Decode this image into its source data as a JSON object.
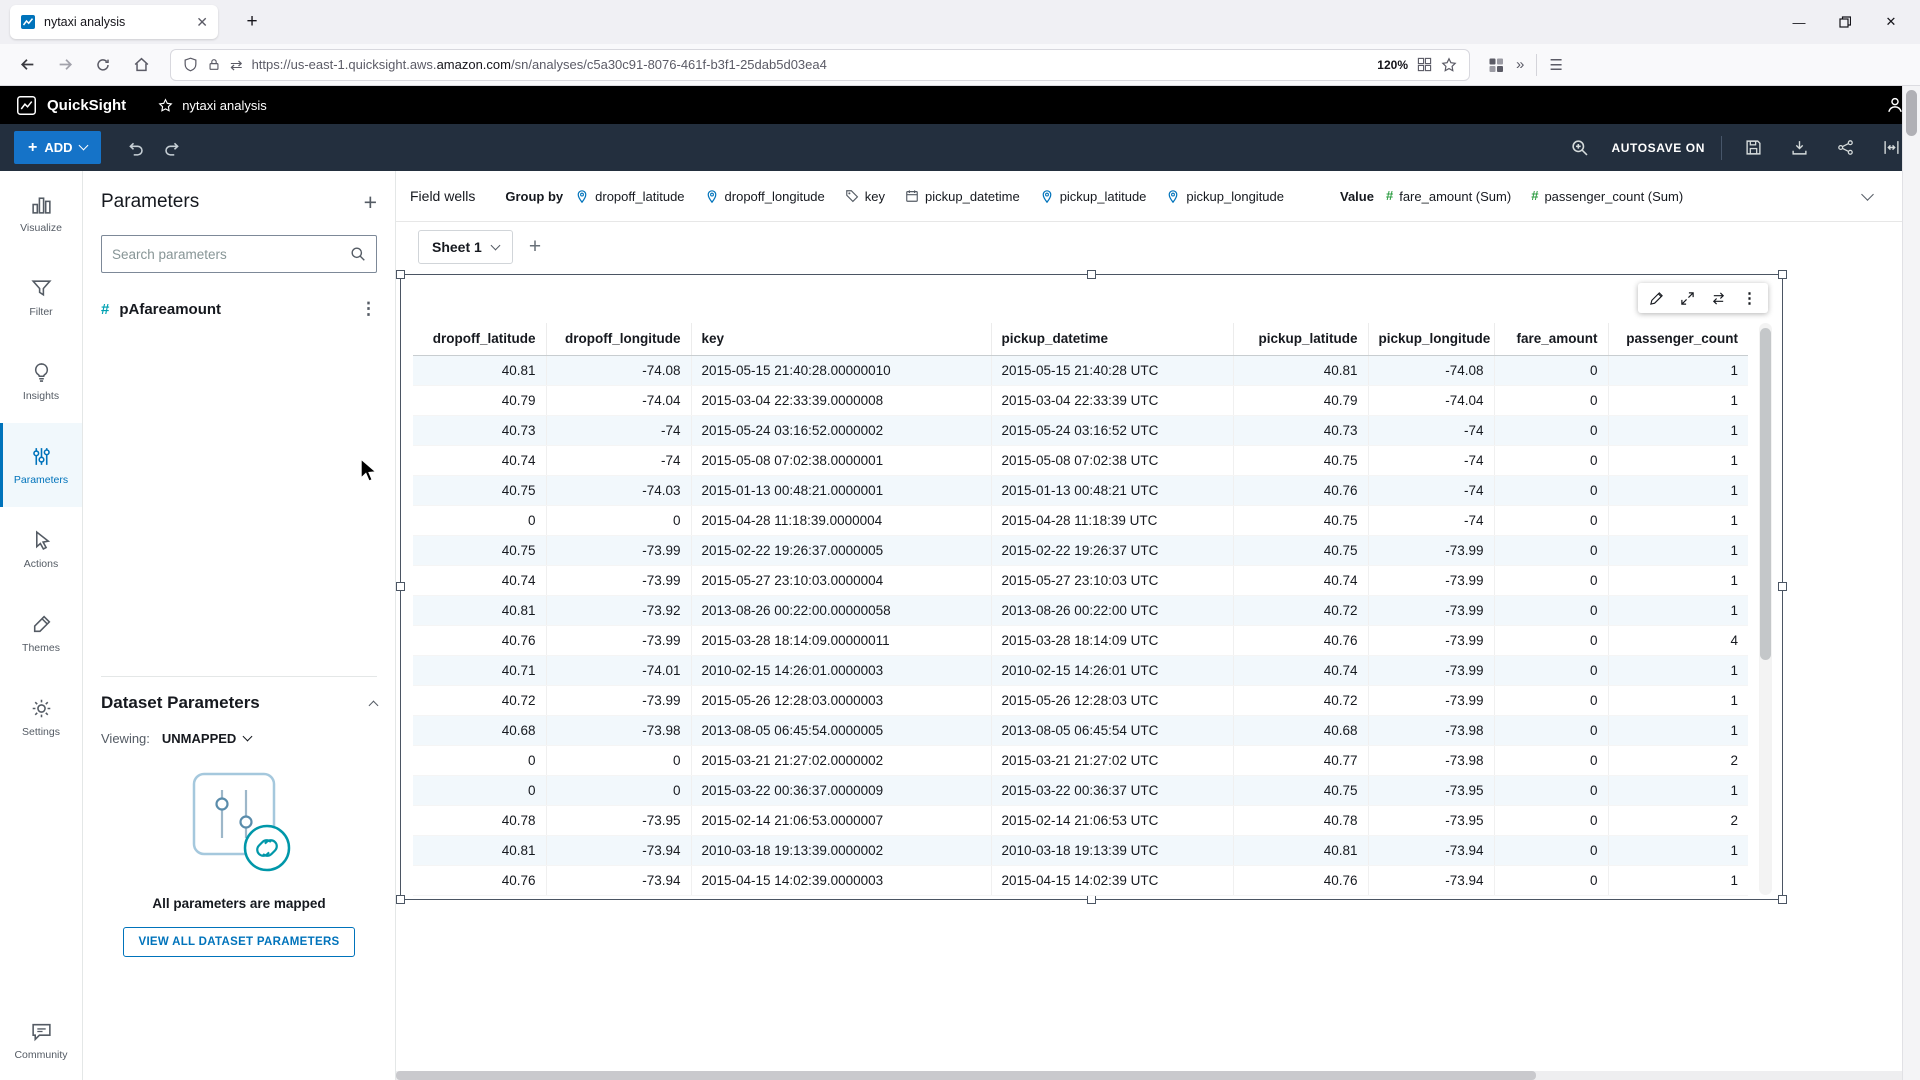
{
  "browser": {
    "tab_title": "nytaxi analysis",
    "url_prefix": "https://us-east-1.quicksight.aws.",
    "url_domain": "amazon.com",
    "url_path": "/sn/analyses/c5a30c91-8076-461f-b3f1-25dab5d03ea4",
    "zoom_badge": "120%"
  },
  "app_header": {
    "brand": "QuickSight",
    "analysis_title": "nytaxi analysis"
  },
  "toolbar": {
    "add_label": "ADD",
    "autosave_label": "AUTOSAVE ON"
  },
  "field_wells": {
    "bar_label": "Field wells",
    "group_by_label": "Group by",
    "value_label": "Value",
    "group_by_fields": [
      {
        "label": "dropoff_latitude",
        "icon": "pin"
      },
      {
        "label": "dropoff_longitude",
        "icon": "pin"
      },
      {
        "label": "key",
        "icon": "tag"
      },
      {
        "label": "pickup_datetime",
        "icon": "calendar"
      },
      {
        "label": "pickup_latitude",
        "icon": "pin"
      },
      {
        "label": "pickup_longitude",
        "icon": "pin"
      }
    ],
    "value_fields": [
      {
        "label": "fare_amount (Sum)",
        "icon": "hash"
      },
      {
        "label": "passenger_count (Sum)",
        "icon": "hash"
      }
    ]
  },
  "sheet_bar": {
    "sheet_name": "Sheet 1"
  },
  "left_rail": {
    "items": [
      {
        "label": "Visualize"
      },
      {
        "label": "Filter"
      },
      {
        "label": "Insights"
      },
      {
        "label": "Parameters"
      },
      {
        "label": "Actions"
      },
      {
        "label": "Themes"
      },
      {
        "label": "Settings"
      }
    ],
    "community_label": "Community"
  },
  "parameters_panel": {
    "title": "Parameters",
    "search_placeholder": "Search parameters",
    "parameter_name": "pAfareamount",
    "dataset_section": {
      "title": "Dataset Parameters",
      "viewing_label": "Viewing:",
      "viewing_value": "UNMAPPED",
      "mapped_message": "All parameters are mapped",
      "view_all_button": "VIEW ALL DATASET PARAMETERS"
    }
  },
  "visual": {
    "table": {
      "columns": [
        "dropoff_latitude",
        "dropoff_longitude",
        "key",
        "pickup_datetime",
        "pickup_latitude",
        "pickup_longitude",
        "fare_amount",
        "passenger_count"
      ],
      "rows": [
        [
          "40.81",
          "-74.08",
          "2015-05-15 21:40:28.00000010",
          "2015-05-15 21:40:28 UTC",
          "40.81",
          "-74.08",
          "0",
          "1"
        ],
        [
          "40.79",
          "-74.04",
          "2015-03-04 22:33:39.0000008",
          "2015-03-04 22:33:39 UTC",
          "40.79",
          "-74.04",
          "0",
          "1"
        ],
        [
          "40.73",
          "-74",
          "2015-05-24 03:16:52.0000002",
          "2015-05-24 03:16:52 UTC",
          "40.73",
          "-74",
          "0",
          "1"
        ],
        [
          "40.74",
          "-74",
          "2015-05-08 07:02:38.0000001",
          "2015-05-08 07:02:38 UTC",
          "40.75",
          "-74",
          "0",
          "1"
        ],
        [
          "40.75",
          "-74.03",
          "2015-01-13 00:48:21.0000001",
          "2015-01-13 00:48:21 UTC",
          "40.76",
          "-74",
          "0",
          "1"
        ],
        [
          "0",
          "0",
          "2015-04-28 11:18:39.0000004",
          "2015-04-28 11:18:39 UTC",
          "40.75",
          "-74",
          "0",
          "1"
        ],
        [
          "40.75",
          "-73.99",
          "2015-02-22 19:26:37.0000005",
          "2015-02-22 19:26:37 UTC",
          "40.75",
          "-73.99",
          "0",
          "1"
        ],
        [
          "40.74",
          "-73.99",
          "2015-05-27 23:10:03.0000004",
          "2015-05-27 23:10:03 UTC",
          "40.74",
          "-73.99",
          "0",
          "1"
        ],
        [
          "40.81",
          "-73.92",
          "2013-08-26 00:22:00.00000058",
          "2013-08-26 00:22:00 UTC",
          "40.72",
          "-73.99",
          "0",
          "1"
        ],
        [
          "40.76",
          "-73.99",
          "2015-03-28 18:14:09.00000011",
          "2015-03-28 18:14:09 UTC",
          "40.76",
          "-73.99",
          "0",
          "4"
        ],
        [
          "40.71",
          "-74.01",
          "2010-02-15 14:26:01.0000003",
          "2010-02-15 14:26:01 UTC",
          "40.74",
          "-73.99",
          "0",
          "1"
        ],
        [
          "40.72",
          "-73.99",
          "2015-05-26 12:28:03.0000003",
          "2015-05-26 12:28:03 UTC",
          "40.72",
          "-73.99",
          "0",
          "1"
        ],
        [
          "40.68",
          "-73.98",
          "2013-08-05 06:45:54.0000005",
          "2013-08-05 06:45:54 UTC",
          "40.68",
          "-73.98",
          "0",
          "1"
        ],
        [
          "0",
          "0",
          "2015-03-21 21:27:02.0000002",
          "2015-03-21 21:27:02 UTC",
          "40.77",
          "-73.98",
          "0",
          "2"
        ],
        [
          "0",
          "0",
          "2015-03-22 00:36:37.0000009",
          "2015-03-22 00:36:37 UTC",
          "40.75",
          "-73.95",
          "0",
          "1"
        ],
        [
          "40.78",
          "-73.95",
          "2015-02-14 21:06:53.0000007",
          "2015-02-14 21:06:53 UTC",
          "40.78",
          "-73.95",
          "0",
          "2"
        ],
        [
          "40.81",
          "-73.94",
          "2010-03-18 19:13:39.0000002",
          "2010-03-18 19:13:39 UTC",
          "40.81",
          "-73.94",
          "0",
          "1"
        ],
        [
          "40.76",
          "-73.94",
          "2015-04-15 14:02:39.0000003",
          "2015-04-15 14:02:39 UTC",
          "40.76",
          "-73.94",
          "0",
          "1"
        ]
      ]
    }
  },
  "colors": {
    "accent_blue": "#0073bb",
    "measure_green": "#2f9e44",
    "parameter_teal": "#00a1b2",
    "toolbar_navy": "#232f3e",
    "add_button_blue": "#1573c8"
  }
}
